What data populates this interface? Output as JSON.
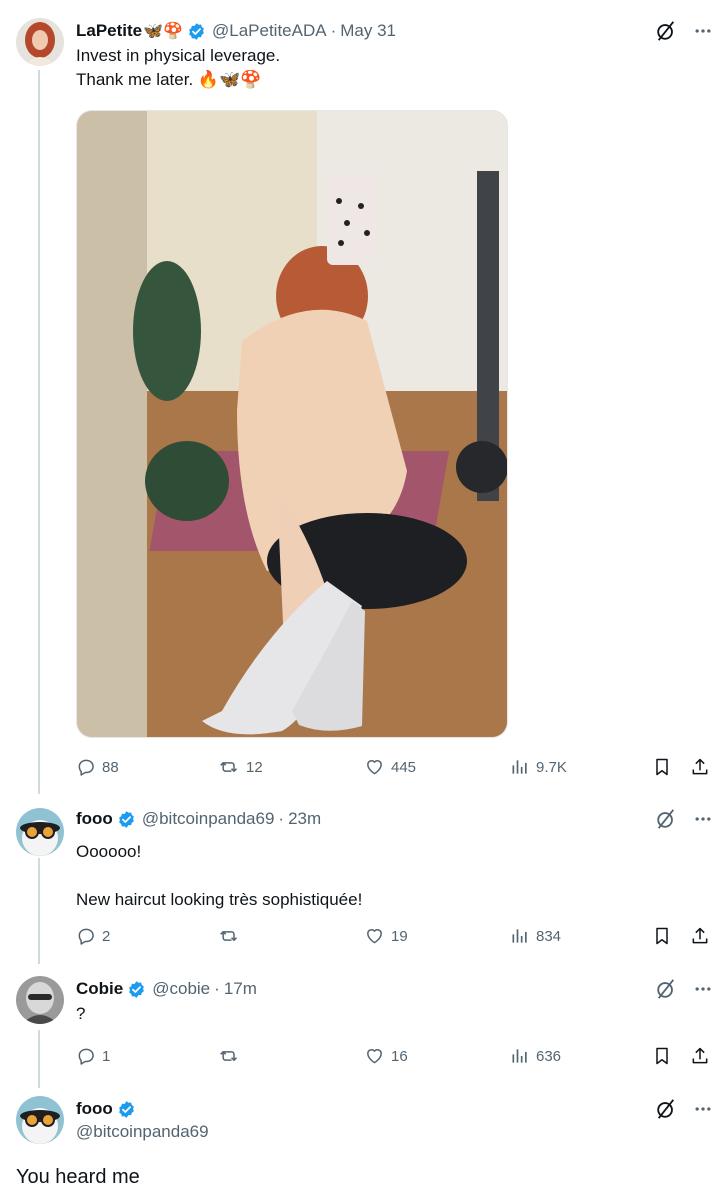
{
  "tweets": [
    {
      "name": "LaPetite",
      "name_emojis": "🦋🍄",
      "handle": "@LaPetiteADA",
      "time": "May 31",
      "text": "Invest in physical leverage.\nThank me later. 🔥🦋🍄",
      "replies": "88",
      "retweets": "12",
      "likes": "445",
      "views": "9.7K"
    },
    {
      "name": "fooo",
      "handle": "@bitcoinpanda69",
      "time": "23m",
      "text": "Oooooo!\n\nNew haircut looking très sophistiquée!",
      "replies": "2",
      "retweets": "",
      "likes": "19",
      "views": "834"
    },
    {
      "name": "Cobie",
      "handle": "@cobie",
      "time": "17m",
      "text": "?",
      "replies": "1",
      "retweets": "",
      "likes": "16",
      "views": "636"
    }
  ],
  "main_tweet": {
    "name": "fooo",
    "handle": "@bitcoinpanda69",
    "text": "You heard me"
  },
  "colors": {
    "verified": "#1d9bf0",
    "muted": "#536471",
    "thread_line": "#cfd9de"
  }
}
